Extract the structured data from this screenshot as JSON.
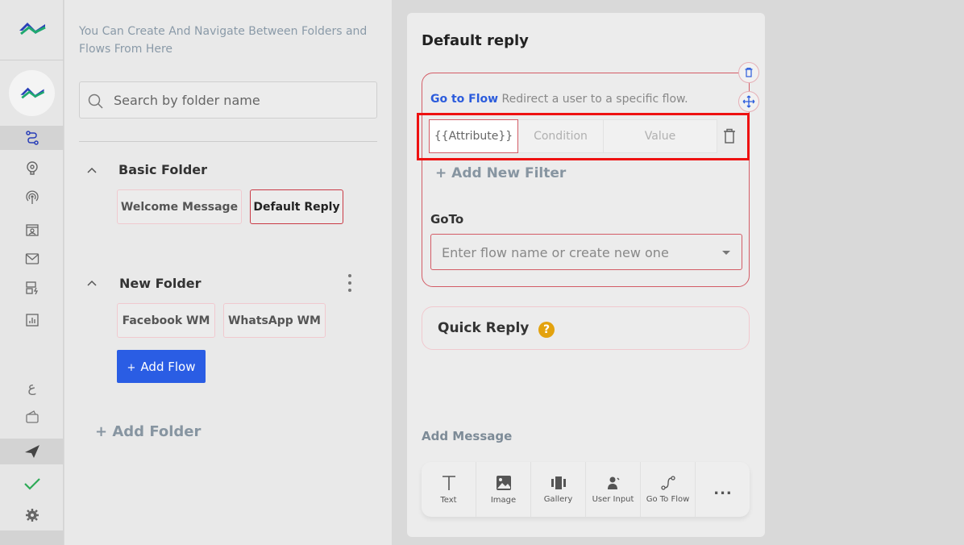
{
  "rail": {
    "items": [
      "flows-icon",
      "bot-brain-icon",
      "broadcast-icon",
      "contacts-icon",
      "mail-icon",
      "automation-icon",
      "analytics-icon"
    ],
    "bottom_items": [
      "language-icon",
      "wallet-icon",
      "send-icon",
      "check-icon",
      "settings-icon"
    ],
    "colors": {
      "brand_blue": "#2a3fb8",
      "brand_green": "#1fa870",
      "check_green": "#2eaa57"
    }
  },
  "folders": {
    "intro": "You Can Create And Navigate Between Folders and Flows From Here",
    "search_placeholder": "Search by folder name",
    "list": [
      {
        "name": "Basic Folder",
        "flows": [
          "Welcome Message",
          "Default Reply"
        ],
        "active_flow": "Default Reply"
      },
      {
        "name": "New Folder",
        "flows": [
          "Facebook WM",
          "WhatsApp WM"
        ]
      }
    ],
    "add_flow_label": "Add Flow",
    "add_flow_plus": "+",
    "add_folder_label": "+ Add Folder"
  },
  "editor": {
    "title": "Default reply",
    "card": {
      "action_label": "Go to Flow",
      "action_desc": "Redirect a user to a specific flow.",
      "condition": {
        "attribute": "{{Attribute}}",
        "condition_placeholder": "Condition",
        "value_placeholder": "Value"
      },
      "add_filter_label": "+ Add New Filter",
      "goto_label": "GoTo",
      "goto_placeholder": "Enter flow name or create new one"
    },
    "quick_reply": {
      "label": "Quick Reply",
      "help": "?"
    },
    "add_message_label": "Add Message",
    "message_types": [
      {
        "label": "Text",
        "icon": "text-icon"
      },
      {
        "label": "Image",
        "icon": "image-icon"
      },
      {
        "label": "Gallery",
        "icon": "gallery-icon"
      },
      {
        "label": "User Input",
        "icon": "user-input-icon"
      },
      {
        "label": "Go To Flow",
        "icon": "go-to-flow-icon"
      }
    ],
    "more_label": "..."
  }
}
